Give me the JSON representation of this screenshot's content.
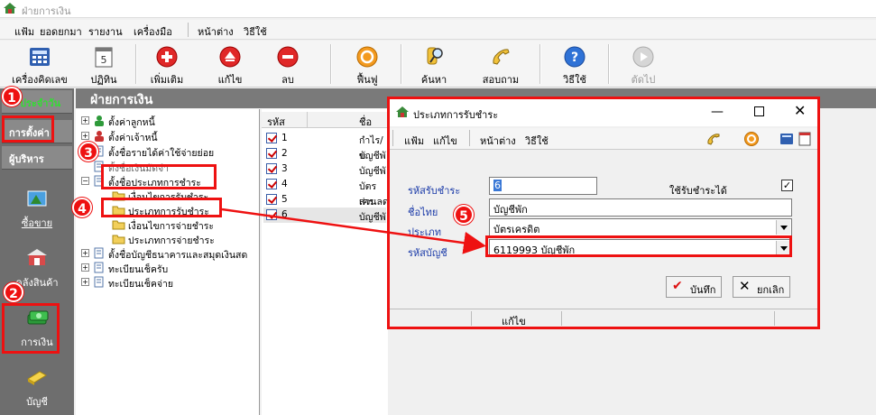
{
  "window": {
    "title": "ฝ่ายการเงิน"
  },
  "menubar": [
    "แฟ้ม",
    "ยอดยกมา",
    "รายงาน",
    "เครื่องมือ",
    "หน้าต่าง",
    "วิธีใช้"
  ],
  "toolbar": {
    "calculator": "เครื่องคิดเลข",
    "calendar": "ปฏิทิน",
    "add": "เพิ่มเติม",
    "edit": "แก้ไข",
    "delete": "ลบ",
    "restore": "ฟื้นฟู",
    "search": "ค้นหา",
    "inquiry": "สอบถาม",
    "help": "วิธีใช้",
    "exit": "ตัดไป"
  },
  "sidebar": {
    "tabs": [
      "ประจำวัน",
      "การตั้งค่า",
      "ผู้บริหาร"
    ],
    "items": [
      "ซื้อขาย",
      "คลังสินค้า",
      "การเงิน",
      "บัญชี"
    ]
  },
  "main": {
    "header": "ฝ่ายการเงิน"
  },
  "tree": [
    "ตั้งค่าลูกหนี้",
    "ตั้งค่าเจ้าหนี้",
    "ตั้งชื่อรายได้ค่าใช้จ่ายย่อย",
    "ตั้งชื่อเงินมัดจำ",
    "ตั้งชื่อประเภทการชำระ",
    "เงื่อนไขการรับชำระ",
    "ประเภทการรับชำระ",
    "เงื่อนไขการจ่ายชำระ",
    "ประเภทการจ่ายชำระ",
    "ตั้งชื่อบัญชีธนาคารและสมุดเงินสด",
    "ทะเบียนเช็ครับ",
    "ทะเบียนเช็คจ่าย"
  ],
  "list": {
    "columns": [
      "รหัส",
      "ชื่อ"
    ],
    "rows": [
      {
        "code": "1",
        "name": "กำไร/ข"
      },
      {
        "code": "2",
        "name": "บัญชีพั"
      },
      {
        "code": "3",
        "name": "บัญชีพั"
      },
      {
        "code": "4",
        "name": "บัตรเคร"
      },
      {
        "code": "5",
        "name": "ส่วนลด"
      },
      {
        "code": "6",
        "name": "บัญชีพั"
      }
    ]
  },
  "dialog": {
    "title": "ประเภทการรับชำระ",
    "menu": [
      "แฟ้ม",
      "แก้ไข",
      "หน้าต่าง",
      "วิธีใช้"
    ],
    "labels": {
      "code": "รหัสรับชำระ",
      "name_th": "ชื่อไทย",
      "type": "ประเภท",
      "account": "รหัสบัญชี",
      "enabled": "ใช้รับชำระได้"
    },
    "values": {
      "code": "6",
      "name_th": "บัญชีพัก",
      "type": "บัตรเครดิต",
      "account": "6119993 บัญชีพัก",
      "enabled": true
    },
    "buttons": {
      "save": "บันทึก",
      "cancel": "ยกเลิก"
    },
    "status": "แก้ไข"
  },
  "callouts": [
    "1",
    "2",
    "3",
    "4",
    "5"
  ],
  "colors": {
    "highlight": "#e11111",
    "sidebar": "#6e6e6e",
    "header": "#7a7a7a"
  }
}
